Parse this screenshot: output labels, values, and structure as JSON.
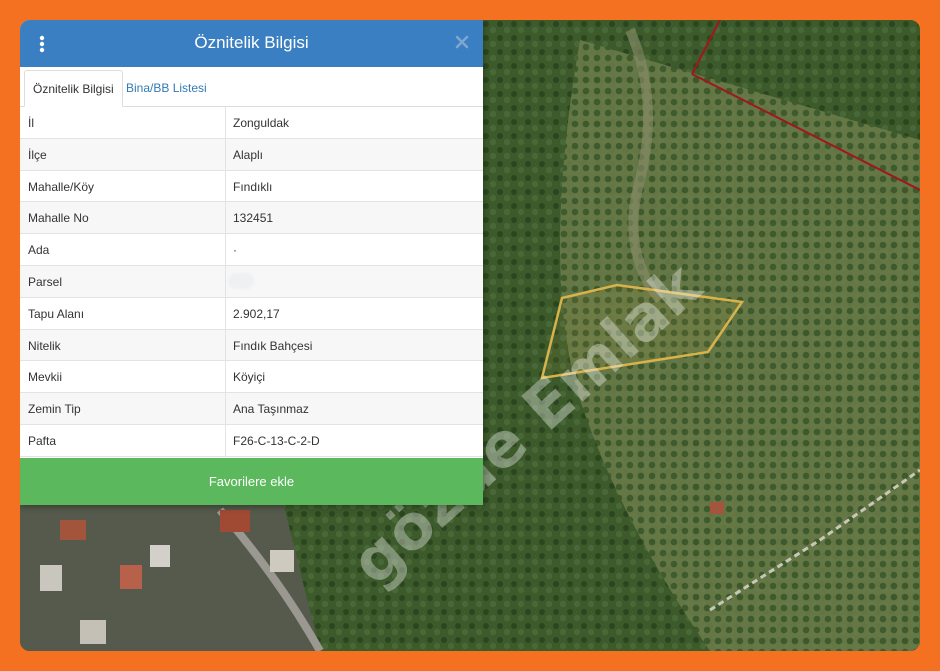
{
  "panel": {
    "title": "Öznitelik Bilgisi",
    "menu_icon": "vertical-dots-icon",
    "close_icon": "close-icon"
  },
  "tabs": [
    {
      "label": "Öznitelik Bilgisi",
      "active": true
    },
    {
      "label": "Bina/BB Listesi",
      "active": false
    }
  ],
  "rows": [
    {
      "key": "İl",
      "value": "Zonguldak"
    },
    {
      "key": "İlçe",
      "value": "Alaplı"
    },
    {
      "key": "Mahalle/Köy",
      "value": "Fındıklı"
    },
    {
      "key": "Mahalle No",
      "value": "132451"
    },
    {
      "key": "Ada",
      "value": "·"
    },
    {
      "key": "Parsel",
      "value": ""
    },
    {
      "key": "Tapu Alanı",
      "value": "2.902,17"
    },
    {
      "key": "Nitelik",
      "value": "Fındık Bahçesi"
    },
    {
      "key": "Mevkii",
      "value": "Köyiçi"
    },
    {
      "key": "Zemin Tip",
      "value": "Ana Taşınmaz"
    },
    {
      "key": "Pafta",
      "value": "F26-C-13-C-2-D"
    }
  ],
  "favorite_button": {
    "label": "Favorilere ekle"
  },
  "watermark": {
    "text": "gözde Emlak"
  },
  "colors": {
    "frame": "#f47121",
    "header": "#3a7fc1",
    "button": "#5cb85c",
    "parcel_outline": "#d8b24a",
    "boundary_line": "#a0171f"
  }
}
